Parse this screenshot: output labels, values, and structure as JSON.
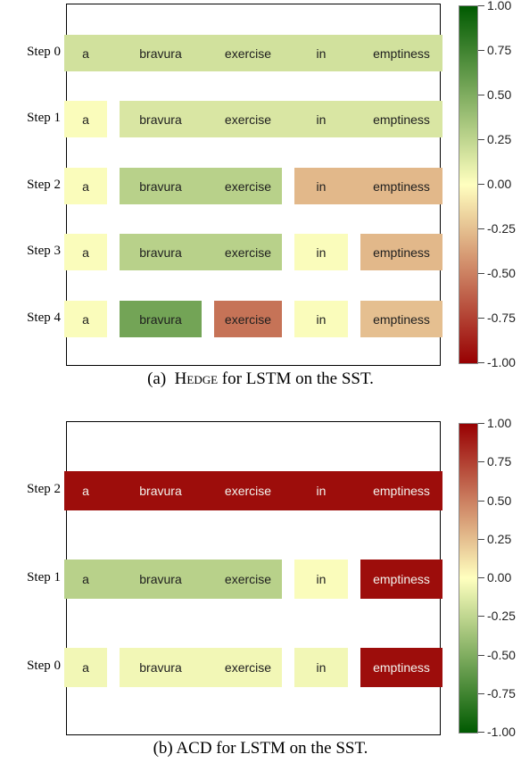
{
  "panel_a": {
    "caption": "(a)  HEDGE for LSTM on the SST.",
    "words": [
      "a",
      "bravura",
      "exercise",
      "in",
      "emptiness"
    ],
    "step_labels": [
      "Step 0",
      "Step 1",
      "Step 2",
      "Step 3",
      "Step 4"
    ],
    "word_widths": [
      48,
      92,
      76,
      60,
      92
    ],
    "gap": 14,
    "steps": [
      {
        "groups": [
          [
            0,
            1,
            2,
            3,
            4
          ]
        ],
        "group_values": [
          0.18
        ]
      },
      {
        "groups": [
          [
            0
          ],
          [
            1,
            2,
            3,
            4
          ]
        ],
        "group_values": [
          0.02,
          0.15
        ]
      },
      {
        "groups": [
          [
            0
          ],
          [
            1,
            2
          ],
          [
            3,
            4
          ]
        ],
        "group_values": [
          0.02,
          0.28,
          -0.28
        ]
      },
      {
        "groups": [
          [
            0
          ],
          [
            1,
            2
          ],
          [
            3
          ],
          [
            4
          ]
        ],
        "group_values": [
          0.02,
          0.28,
          0.02,
          -0.28
        ]
      },
      {
        "groups": [
          [
            0
          ],
          [
            1
          ],
          [
            2
          ],
          [
            3
          ],
          [
            4
          ]
        ],
        "group_values": [
          0.02,
          0.55,
          -0.55,
          0.02,
          -0.25
        ]
      }
    ],
    "colorbar_ticks": [
      1.0,
      0.75,
      0.5,
      0.25,
      0.0,
      -0.25,
      -0.5,
      -0.75,
      -1.0
    ],
    "colorbar_labels": [
      "1.00",
      "0.75",
      "0.50",
      "0.25",
      "0.00",
      "-0.25",
      "-0.50",
      "-0.75",
      "-1.00"
    ],
    "cmap": {
      "type": "diverging",
      "low": "#980002",
      "mid": "#ffffbf",
      "high": "#005a01"
    }
  },
  "panel_b": {
    "caption": "(b)  ACD for LSTM on the SST.",
    "words": [
      "a",
      "bravura",
      "exercise",
      "in",
      "emptiness"
    ],
    "step_labels": [
      "Step 2",
      "Step 1",
      "Step 0"
    ],
    "word_widths": [
      48,
      92,
      76,
      60,
      92
    ],
    "gap": 14,
    "steps": [
      {
        "groups": [
          [
            0,
            1,
            2,
            3,
            4
          ]
        ],
        "group_values": [
          0.95
        ]
      },
      {
        "groups": [
          [
            0,
            1,
            2
          ],
          [
            3
          ],
          [
            4
          ]
        ],
        "group_values": [
          -0.28,
          -0.02,
          0.95
        ]
      },
      {
        "groups": [
          [
            0
          ],
          [
            1,
            2
          ],
          [
            3
          ],
          [
            4
          ]
        ],
        "group_values": [
          -0.05,
          -0.05,
          -0.05,
          0.95
        ]
      }
    ],
    "colorbar_ticks": [
      1.0,
      0.75,
      0.5,
      0.25,
      0.0,
      -0.25,
      -0.5,
      -0.75,
      -1.0
    ],
    "colorbar_labels": [
      "1.00",
      "0.75",
      "0.50",
      "0.25",
      "0.00",
      "-0.25",
      "-0.50",
      "-0.75",
      "-1.00"
    ],
    "cmap": {
      "type": "diverging",
      "low": "#005a01",
      "mid": "#ffffbf",
      "high": "#980002"
    }
  },
  "chart_data": [
    {
      "type": "heatmap",
      "title": "HEDGE for LSTM on the SST",
      "words": [
        "a",
        "bravura",
        "exercise",
        "in",
        "emptiness"
      ],
      "y_labels": [
        "Step 0",
        "Step 1",
        "Step 2",
        "Step 3",
        "Step 4"
      ],
      "rows": [
        {
          "label": "Step 0",
          "spans": [
            {
              "idx": [
                0,
                1,
                2,
                3,
                4
              ],
              "value": 0.18
            }
          ]
        },
        {
          "label": "Step 1",
          "spans": [
            {
              "idx": [
                0
              ],
              "value": 0.02
            },
            {
              "idx": [
                1,
                2,
                3,
                4
              ],
              "value": 0.15
            }
          ]
        },
        {
          "label": "Step 2",
          "spans": [
            {
              "idx": [
                0
              ],
              "value": 0.02
            },
            {
              "idx": [
                1,
                2
              ],
              "value": 0.28
            },
            {
              "idx": [
                3,
                4
              ],
              "value": -0.28
            }
          ]
        },
        {
          "label": "Step 3",
          "spans": [
            {
              "idx": [
                0
              ],
              "value": 0.02
            },
            {
              "idx": [
                1,
                2
              ],
              "value": 0.28
            },
            {
              "idx": [
                3
              ],
              "value": 0.02
            },
            {
              "idx": [
                4
              ],
              "value": -0.28
            }
          ]
        },
        {
          "label": "Step 4",
          "spans": [
            {
              "idx": [
                0
              ],
              "value": 0.02
            },
            {
              "idx": [
                1
              ],
              "value": 0.55
            },
            {
              "idx": [
                2
              ],
              "value": -0.55
            },
            {
              "idx": [
                3
              ],
              "value": 0.02
            },
            {
              "idx": [
                4
              ],
              "value": -0.25
            }
          ]
        }
      ],
      "color_range": [
        -1,
        1
      ],
      "colorbar_ticks": [
        -1.0,
        -0.75,
        -0.5,
        -0.25,
        0.0,
        0.25,
        0.5,
        0.75,
        1.0
      ]
    },
    {
      "type": "heatmap",
      "title": "ACD for LSTM on the SST",
      "words": [
        "a",
        "bravura",
        "exercise",
        "in",
        "emptiness"
      ],
      "y_labels": [
        "Step 2",
        "Step 1",
        "Step 0"
      ],
      "rows": [
        {
          "label": "Step 2",
          "spans": [
            {
              "idx": [
                0,
                1,
                2,
                3,
                4
              ],
              "value": 0.95
            }
          ]
        },
        {
          "label": "Step 1",
          "spans": [
            {
              "idx": [
                0,
                1,
                2
              ],
              "value": -0.28
            },
            {
              "idx": [
                3
              ],
              "value": -0.02
            },
            {
              "idx": [
                4
              ],
              "value": 0.95
            }
          ]
        },
        {
          "label": "Step 0",
          "spans": [
            {
              "idx": [
                0
              ],
              "value": -0.05
            },
            {
              "idx": [
                1,
                2
              ],
              "value": -0.05
            },
            {
              "idx": [
                3
              ],
              "value": -0.05
            },
            {
              "idx": [
                4
              ],
              "value": 0.95
            }
          ]
        }
      ],
      "color_range": [
        -1,
        1
      ],
      "colorbar_ticks": [
        -1.0,
        -0.75,
        -0.5,
        -0.25,
        0.0,
        0.25,
        0.5,
        0.75,
        1.0
      ]
    }
  ]
}
